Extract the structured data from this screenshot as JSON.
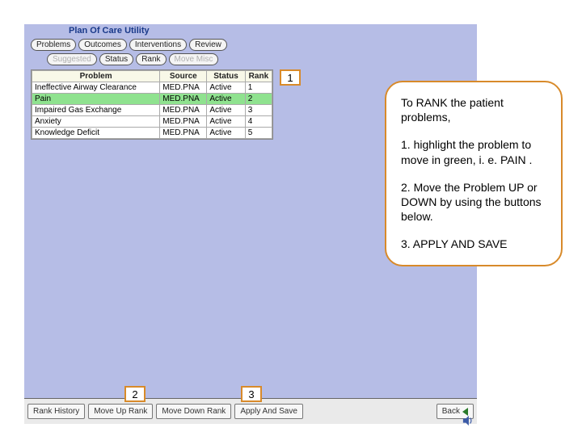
{
  "window_title": "Plan Of Care Utility",
  "tabs_primary": [
    {
      "label": "Problems"
    },
    {
      "label": "Outcomes"
    },
    {
      "label": "Interventions"
    },
    {
      "label": "Review"
    }
  ],
  "tabs_secondary": [
    {
      "label": "Suggested",
      "dim": true
    },
    {
      "label": "Status"
    },
    {
      "label": "Rank"
    },
    {
      "label": "Move Misc",
      "dim": true
    }
  ],
  "grid": {
    "headers": {
      "problem": "Problem",
      "source": "Source",
      "status": "Status",
      "rank": "Rank"
    },
    "rows": [
      {
        "problem": "Ineffective Airway Clearance",
        "source": "MED.PNA",
        "status": "Active",
        "rank": "1",
        "hl": false
      },
      {
        "problem": "Pain",
        "source": "MED.PNA",
        "status": "Active",
        "rank": "2",
        "hl": true
      },
      {
        "problem": "Impaired Gas Exchange",
        "source": "MED.PNA",
        "status": "Active",
        "rank": "3",
        "hl": false
      },
      {
        "problem": "Anxiety",
        "source": "MED.PNA",
        "status": "Active",
        "rank": "4",
        "hl": false
      },
      {
        "problem": "Knowledge Deficit",
        "source": "MED.PNA",
        "status": "Active",
        "rank": "5",
        "hl": false
      }
    ]
  },
  "bottom_buttons": {
    "rank_history": "Rank History",
    "move_up": "Move Up Rank",
    "move_down": "Move Down Rank",
    "apply_save": "Apply And Save",
    "back": "Back"
  },
  "markers": {
    "one": "1",
    "two": "2",
    "three": "3"
  },
  "callout": {
    "intro": "To RANK the patient problems,",
    "step1": "1. highlight the problem to move in green, i. e. PAIN .",
    "step2": "2. Move the Problem UP or DOWN by using the buttons below.",
    "step3": "3. APPLY AND SAVE"
  }
}
